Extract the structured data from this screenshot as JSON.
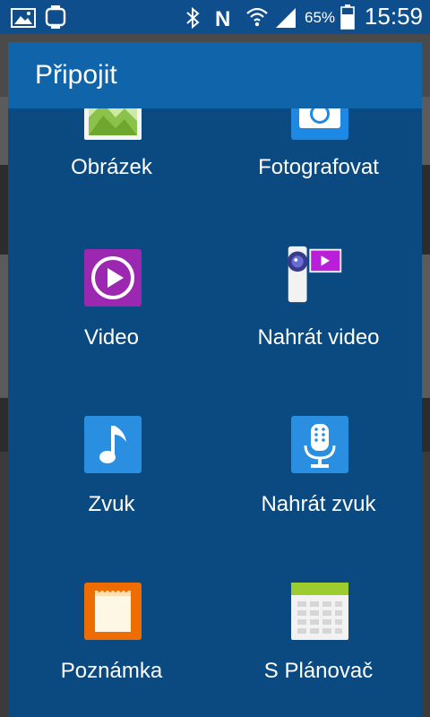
{
  "status_bar": {
    "battery_percent": "65%",
    "time": "15:59",
    "icons": [
      "gallery-icon",
      "watch-icon",
      "bluetooth-icon",
      "nfc-icon",
      "wifi-icon",
      "signal-icon",
      "battery-icon"
    ]
  },
  "dialog": {
    "title": "Připojit",
    "items": [
      {
        "label": "Obrázek",
        "icon": "image-icon",
        "color": "#8bc34a"
      },
      {
        "label": "Fotografovat",
        "icon": "camera-icon",
        "color": "#1e88e5"
      },
      {
        "label": "Video",
        "icon": "video-play-icon",
        "color": "#9c27b0"
      },
      {
        "label": "Nahrát video",
        "icon": "camcorder-icon",
        "color": "#b81fd6"
      },
      {
        "label": "Zvuk",
        "icon": "music-note-icon",
        "color": "#2a8fe0"
      },
      {
        "label": "Nahrát zvuk",
        "icon": "voice-recorder-icon",
        "color": "#2a8fe0"
      },
      {
        "label": "Poznámka",
        "icon": "memo-icon",
        "color": "#ef6c00"
      },
      {
        "label": "S Plánovač",
        "icon": "calendar-icon",
        "color": "#8bc34a"
      }
    ]
  }
}
